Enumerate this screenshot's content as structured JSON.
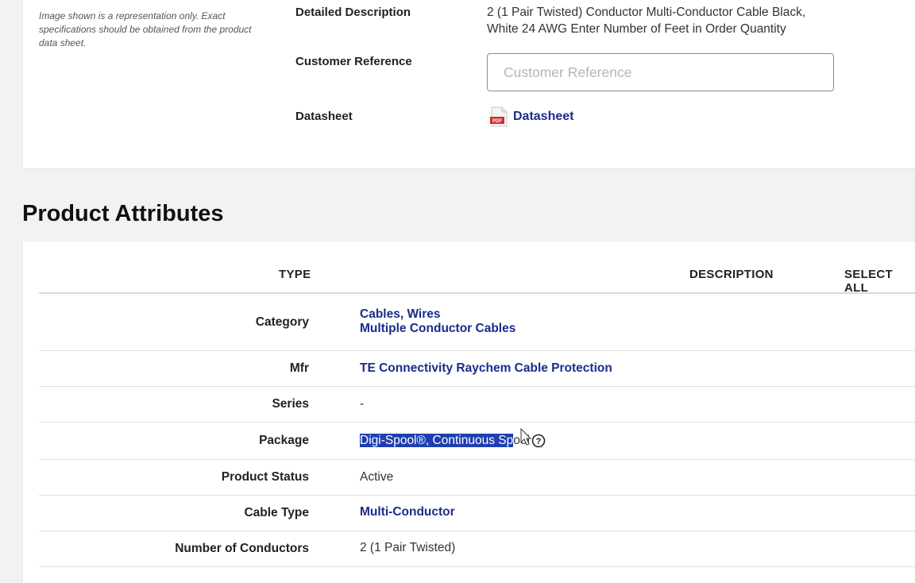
{
  "top_card": {
    "image_note": "Image shown is a representation only. Exact specifications should be obtained from the product data sheet.",
    "detailed_description_label": "Detailed Description",
    "detailed_description_value": "2 (1 Pair Twisted) Conductor Multi-Conductor Cable Black, White 24 AWG Enter Number of Feet in Order Quantity",
    "customer_reference_label": "Customer Reference",
    "customer_reference_placeholder": "Customer Reference",
    "customer_reference_value": "",
    "datasheet_label": "Datasheet",
    "datasheet_link": "Datasheet",
    "datasheet_icon": "pdf-icon"
  },
  "section": {
    "title": "Product Attributes"
  },
  "table": {
    "headers": {
      "type": "TYPE",
      "description": "DESCRIPTION",
      "select_all": "SELECT ALL"
    },
    "rows": [
      {
        "type": "Category",
        "value_line1": "Cables, Wires",
        "value_line2": "Multiple Conductor Cables"
      },
      {
        "type": "Mfr",
        "value": "TE Connectivity Raychem Cable Protection"
      },
      {
        "type": "Series",
        "value": "-"
      },
      {
        "type": "Package",
        "value_selected": "Digi-Spool®, Continuous Sp",
        "value_rest": "ool",
        "help_icon": "help-circle-icon"
      },
      {
        "type": "Product Status",
        "value": "Active"
      },
      {
        "type": "Cable Type",
        "value": "Multi-Conductor"
      },
      {
        "type": "Number of Conductors",
        "value": "2 (1 Pair Twisted)"
      }
    ]
  },
  "colors": {
    "link": "#1a2b8c",
    "selection": "#1f3fb0",
    "page_bg": "#f2f2f2",
    "card_bg": "#ffffff"
  }
}
